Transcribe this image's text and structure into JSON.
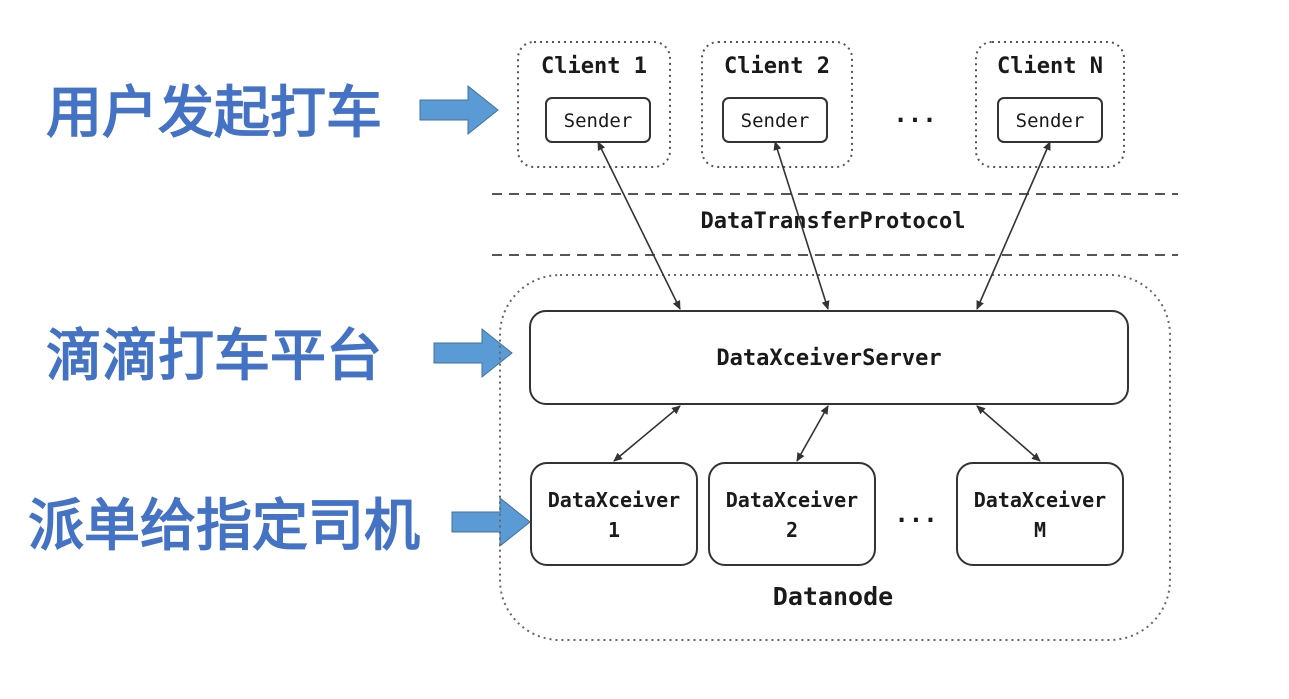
{
  "side_labels": {
    "client_request": "用户发起打车",
    "platform": "滴滴打车平台",
    "dispatch": "派单给指定司机"
  },
  "clients": [
    {
      "title": "Client 1",
      "sender": "Sender"
    },
    {
      "title": "Client 2",
      "sender": "Sender"
    },
    {
      "title": "Client N",
      "sender": "Sender"
    }
  ],
  "clients_ellipsis": "...",
  "protocol_label": "DataTransferProtocol",
  "server_label": "DataXceiverServer",
  "receivers": [
    {
      "name": "DataXceiver",
      "index": "1"
    },
    {
      "name": "DataXceiver",
      "index": "2"
    },
    {
      "name": "DataXceiver",
      "index": "M"
    }
  ],
  "receivers_ellipsis": "...",
  "datanode_label": "Datanode",
  "colors": {
    "label_blue": "#4472c4",
    "arrow_blue": "#5b9bd5",
    "line": "#333333"
  }
}
